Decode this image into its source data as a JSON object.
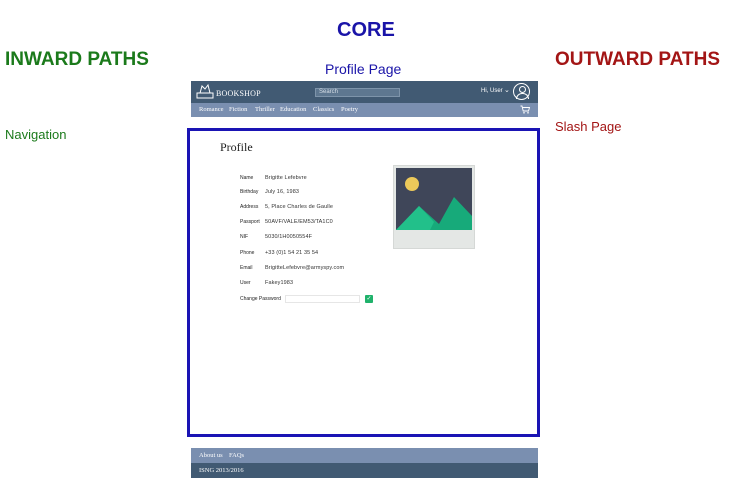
{
  "labels": {
    "core_title": "CORE",
    "inward_title": "INWARD PATHS",
    "outward_title": "OUTWARD PATHS",
    "core_subtitle": "Profile Page",
    "inward_item": "Navigation",
    "outward_item": "Slash Page"
  },
  "app": {
    "logo_icon": "bookshop-icon",
    "brand": "BOOKSHOP",
    "search_placeholder": "Search",
    "user_label": "Hi, User",
    "nav_items": [
      "Romance",
      "Fiction",
      "Thriller",
      "Education",
      "Classics",
      "Poetry"
    ],
    "cart_icon": "cart-icon"
  },
  "profile": {
    "heading": "Profile",
    "fields": [
      {
        "label": "Name",
        "value": "Brigitte Lefebvre"
      },
      {
        "label": "Birthday",
        "value": "July 16, 1983"
      },
      {
        "label": "Address",
        "value": "5, Place Charles de Gaulle"
      },
      {
        "label": "Passport",
        "value": "50AVF/VALE/EM53/TA1C0"
      },
      {
        "label": "NIF",
        "value": "5030/1H0050554F"
      },
      {
        "label": "Phone",
        "value": "+33 (0)1 54 21 35 54"
      },
      {
        "label": "Email",
        "value": "BrigitteLefebvre@armyspy.com"
      },
      {
        "label": "User",
        "value": "Fakey1983"
      },
      {
        "label": "Change Password",
        "value": ""
      }
    ],
    "image_icon": "image-placeholder-icon",
    "checkbox_checked": true
  },
  "footer": {
    "links": [
      "About us",
      "FAQs"
    ],
    "bottom_text": "ISNG 2013/2016"
  },
  "colors": {
    "core": "#1a14a8",
    "inward": "#1b7a1b",
    "outward": "#a31515",
    "topbar": "#415a73",
    "navbar": "#7a8fb0",
    "frame": "#1a14b4",
    "checkbox": "#1fb26b"
  }
}
